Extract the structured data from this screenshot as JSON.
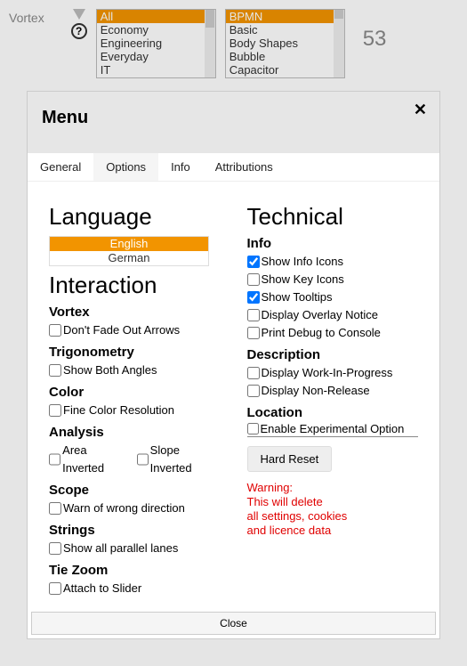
{
  "bg": {
    "title": "Vortex",
    "count": "53",
    "list1": {
      "items": [
        "All",
        "Economy",
        "Engineering",
        "Everyday",
        "IT"
      ],
      "selectedIndex": 0
    },
    "list2": {
      "items": [
        "BPMN",
        "Basic",
        "Body Shapes",
        "Bubble",
        "Capacitor"
      ],
      "selectedIndex": 0
    }
  },
  "dialog": {
    "title": "Menu",
    "close_glyph": "✕",
    "tabs": [
      "General",
      "Options",
      "Info",
      "Attributions"
    ],
    "activeTab": 1,
    "close_button": "Close"
  },
  "left": {
    "language_heading": "Language",
    "languages": [
      "English",
      "German"
    ],
    "language_selected": 0,
    "interaction_heading": "Interaction",
    "groups": [
      {
        "title": "Vortex",
        "opts": [
          {
            "label": "Don't Fade Out Arrows",
            "checked": false
          }
        ]
      },
      {
        "title": "Trigonometry",
        "opts": [
          {
            "label": "Show Both Angles",
            "checked": false
          }
        ]
      },
      {
        "title": "Color",
        "opts": [
          {
            "label": "Fine Color Resolution",
            "checked": false
          }
        ]
      },
      {
        "title": "Analysis",
        "opts": [
          {
            "label": "Area Inverted",
            "checked": false
          },
          {
            "label": "Slope Inverted",
            "checked": false
          }
        ],
        "inline": true
      },
      {
        "title": "Scope",
        "opts": [
          {
            "label": "Warn of wrong direction",
            "checked": false
          }
        ]
      },
      {
        "title": "Strings",
        "opts": [
          {
            "label": "Show all parallel lanes",
            "checked": false
          }
        ]
      },
      {
        "title": "Tie Zoom",
        "opts": [
          {
            "label": "Attach to Slider",
            "checked": false
          }
        ]
      }
    ]
  },
  "right": {
    "technical_heading": "Technical",
    "info_title": "Info",
    "info_opts": [
      {
        "label": "Show Info Icons",
        "checked": true
      },
      {
        "label": "Show Key Icons",
        "checked": false
      },
      {
        "label": "Show Tooltips",
        "checked": true
      },
      {
        "label": "Display Overlay Notice",
        "checked": false
      },
      {
        "label": "Print Debug to Console",
        "checked": false
      }
    ],
    "desc_title": "Description",
    "desc_opts": [
      {
        "label": "Display Work-In-Progress",
        "checked": false
      },
      {
        "label": "Display Non-Release",
        "checked": false
      }
    ],
    "loc_title": "Location",
    "loc_opt": {
      "label": "Enable Experimental Option",
      "checked": false
    },
    "reset_button": "Hard Reset",
    "warning_lines": [
      "Warning:",
      "This will delete",
      "all settings, cookies",
      "and licence data"
    ]
  }
}
